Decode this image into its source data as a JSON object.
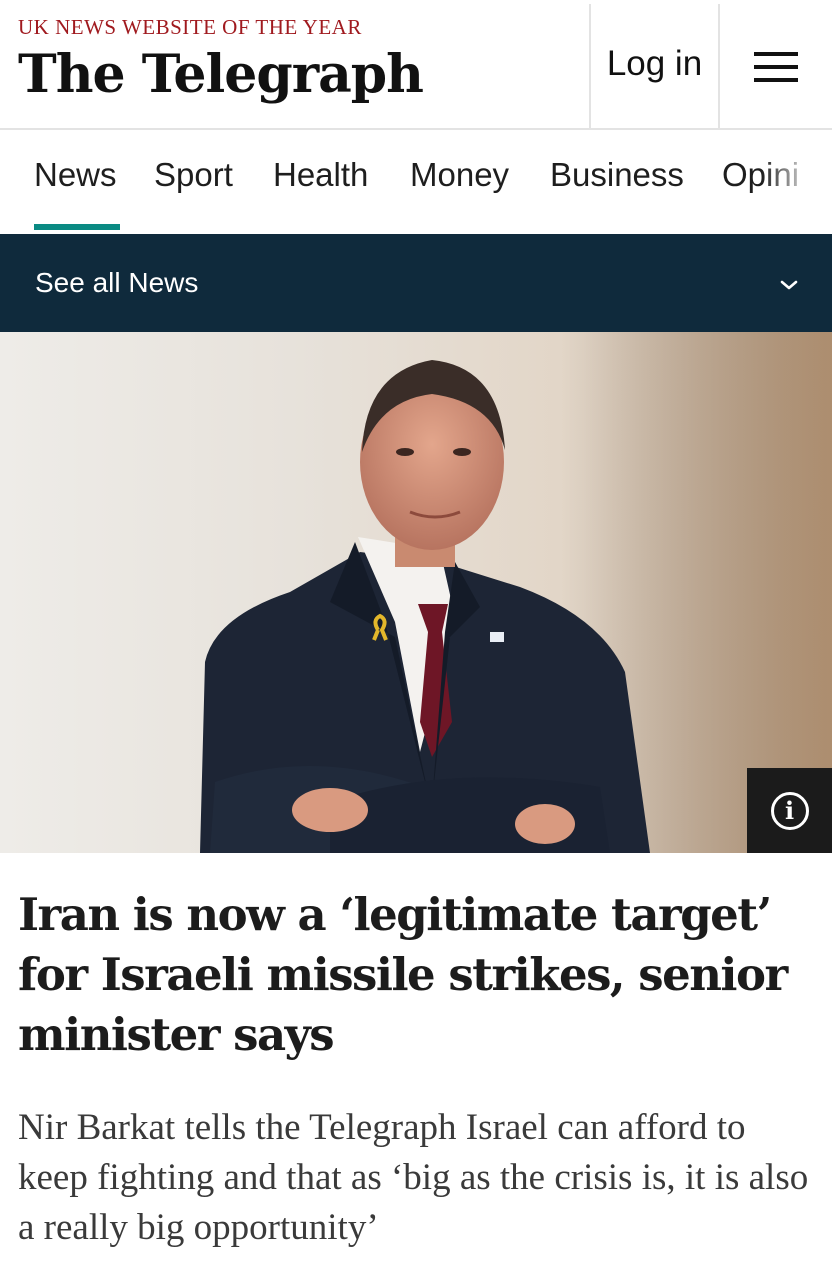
{
  "header": {
    "tagline": "UK NEWS WEBSITE OF THE YEAR",
    "logo": "The Telegraph",
    "login_label": "Log in",
    "menu_icon": "hamburger-menu-icon"
  },
  "nav": {
    "items": [
      {
        "label": "News",
        "active": true
      },
      {
        "label": "Sport"
      },
      {
        "label": "Health"
      },
      {
        "label": "Money"
      },
      {
        "label": "Business"
      },
      {
        "label": "Opini"
      }
    ],
    "active_color": "#0a8a83"
  },
  "section_bar": {
    "label": "See all News",
    "icon": "chevron-down-icon",
    "background": "#0f2a3c"
  },
  "hero_image": {
    "info_icon": "info-icon",
    "info_glyph": "i"
  },
  "article": {
    "headline": "Iran is now a ‘legitimate target’ for Israeli missile strikes, senior minister says",
    "standfirst": "Nir Barkat tells the Telegraph Israel can afford to keep fighting and that as ‘big as the crisis is, it is also a really big opportunity’"
  }
}
